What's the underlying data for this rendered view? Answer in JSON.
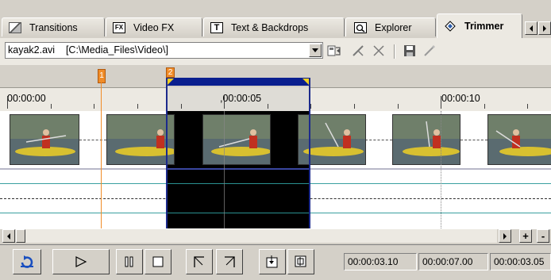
{
  "tabs": [
    {
      "label": "Transitions",
      "icon": "transitions-icon"
    },
    {
      "label": "Video FX",
      "icon": "video-fx-icon"
    },
    {
      "label": "Text & Backdrops",
      "icon": "text-backdrops-icon"
    },
    {
      "label": "Explorer",
      "icon": "explorer-icon"
    },
    {
      "label": "Trimmer",
      "icon": "trimmer-icon",
      "active": true
    }
  ],
  "toolbar": {
    "file": "kayak2.avi    [C:\\Media_Files\\Video\\]",
    "icons": [
      "add-to-timeline-icon",
      "trim-icon",
      "delete-icon",
      "save-icon",
      "edit-icon"
    ]
  },
  "markers": [
    "1",
    "2"
  ],
  "ruler": {
    "labels": [
      "00:00:00",
      ",00:00:05",
      "00:00:10"
    ]
  },
  "transport": {
    "buttons": [
      "loop-icon",
      "play-icon",
      "pause-icon",
      "stop-icon",
      "mark-in-icon",
      "mark-out-icon",
      "insert-selection-icon",
      "add-selection-icon"
    ],
    "selection_start": "00:00:03.10",
    "selection_end": "00:00:07.00",
    "selection_length": "00:00:03.05"
  },
  "colors": {
    "selection": "#0a1f8f",
    "marker": "#f08c28",
    "track_line": "#3aa0a0"
  }
}
